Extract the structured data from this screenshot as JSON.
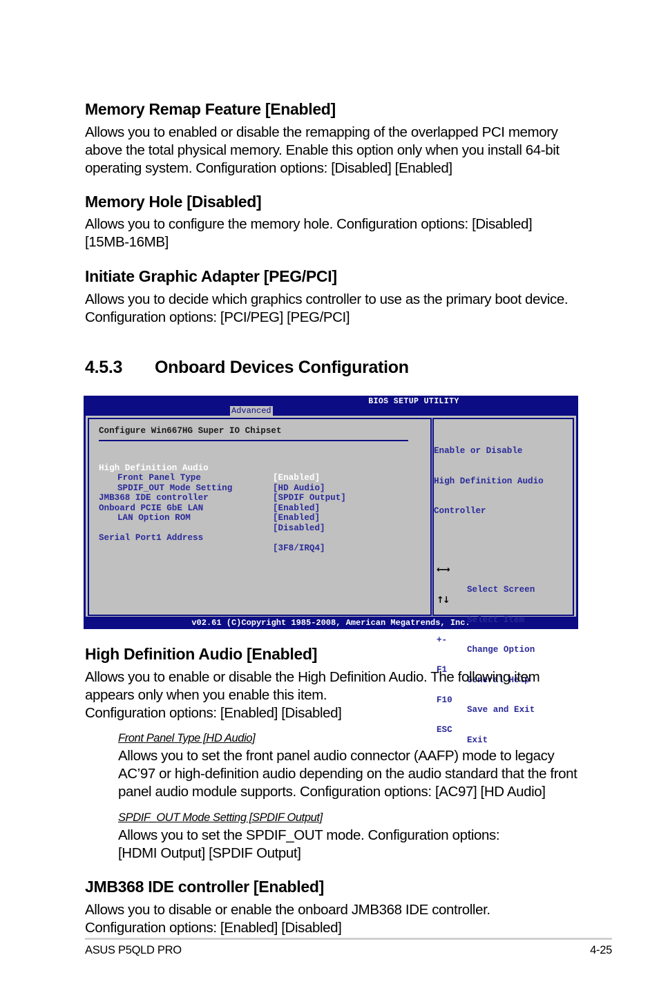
{
  "sections": {
    "memory_remap": {
      "title": "Memory Remap Feature [Enabled]",
      "lines": [
        "Allows you to enabled or disable the remapping of the overlapped PCI memory",
        "above the total physical memory. Enable this option only when you install 64-bit",
        "operating system. Configuration options: [Disabled] [Enabled]"
      ]
    },
    "memory_hole": {
      "title": "Memory Hole [Disabled]",
      "lines": [
        "Allows you to configure the memory hole. Configuration options: [Disabled]",
        "[15MB-16MB]"
      ]
    },
    "graphic_adapter": {
      "title": "Initiate Graphic Adapter [PEG/PCI]",
      "lines": [
        "Allows you to decide which graphics controller to use as the primary boot device.",
        "Configuration options: [PCI/PEG] [PEG/PCI]"
      ]
    },
    "onboard": {
      "number": "4.5.3",
      "title": "Onboard Devices Configuration"
    },
    "hd_audio": {
      "title": "High Definition Audio [Enabled]",
      "lines": [
        "Allows you to enable or disable the High Definition Audio. The following item",
        "appears only when you enable this item.",
        "Configuration options: [Enabled] [Disabled]"
      ]
    },
    "front_panel": {
      "title": "Front Panel Type [HD Audio]",
      "lines": [
        "Allows you to set the front panel audio connector (AAFP) mode to legacy",
        "AC’97 or high-definition audio depending on the audio standard that the front",
        "panel audio module supports. Configuration options: [AC97] [HD Audio]"
      ]
    },
    "spdif": {
      "title": "SPDIF_OUT Mode Setting [SPDIF Output]",
      "lines": [
        "Allows you to set the SPDIF_OUT mode. Configuration options:",
        "[HDMI Output] [SPDIF Output]"
      ]
    },
    "jmb368": {
      "title": "JMB368 IDE controller [Enabled]",
      "lines": [
        "Allows you to disable or enable the onboard JMB368 IDE controller.",
        "Configuration options: [Enabled] [Disabled]"
      ]
    }
  },
  "bios": {
    "title": "BIOS SETUP UTILITY",
    "active_tab": "Advanced",
    "header": "Configure Win667HG Super IO Chipset",
    "rows": [
      {
        "label": "High Definition Audio",
        "value": "[Enabled]"
      },
      {
        "label": "Front Panel Type",
        "value": "[HD Audio]"
      },
      {
        "label": "SPDIF_OUT Mode Setting",
        "value": "[SPDIF Output]"
      },
      {
        "label": "JMB368 IDE controller",
        "value": "[Enabled]"
      },
      {
        "label": "Onboard PCIE GbE LAN",
        "value": "[Enabled]"
      },
      {
        "label": "LAN Option ROM",
        "value": "[Disabled]"
      },
      {
        "label": "Serial Port1 Address",
        "value": "[3F8/IRQ4]"
      }
    ],
    "help_lines": [
      "Enable or Disable",
      "High Definition Audio",
      "Controller"
    ],
    "keys": [
      {
        "key": "←→",
        "icon": "left-right-arrows-icon",
        "desc": "Select Screen"
      },
      {
        "key": "↑↓",
        "icon": "up-down-arrows-icon",
        "desc": "Select Item"
      },
      {
        "key": "+-",
        "desc": "Change Option"
      },
      {
        "key": "F1",
        "desc": "General Help"
      },
      {
        "key": "F10",
        "desc": "Save and Exit"
      },
      {
        "key": "ESC",
        "desc": "Exit"
      }
    ],
    "footer": "v02.61 (C)Copyright 1985-2008, American Megatrends, Inc.",
    "colors": {
      "frame": "#0c0c84",
      "panel": "#c0c0c0",
      "item_text": "#2a2a9a",
      "selected_text": "#ffffff"
    }
  },
  "footer": {
    "product": "ASUS P5QLD PRO",
    "page": "4-25"
  }
}
